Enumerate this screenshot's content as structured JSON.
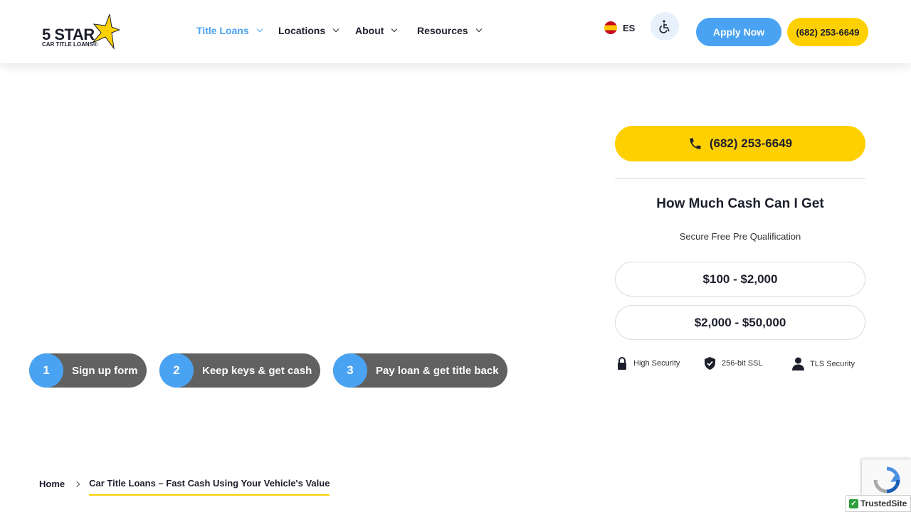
{
  "header": {
    "logo": {
      "big": "5 STAR",
      "small": "CAR TITLE LOANS®"
    },
    "nav": [
      {
        "label": "Title Loans",
        "active": true
      },
      {
        "label": "Locations",
        "active": false
      },
      {
        "label": "About",
        "active": false
      },
      {
        "label": "Resources",
        "active": false
      }
    ],
    "language": "ES",
    "apply_label": "Apply Now",
    "phone": "(682) 253-6649"
  },
  "steps": [
    {
      "number": "1",
      "label": "Sign up form"
    },
    {
      "number": "2",
      "label": "Keep keys & get cash"
    },
    {
      "number": "3",
      "label": "Pay loan & get title back"
    }
  ],
  "sidebar": {
    "phone": "(682) 253-6649",
    "title": "How Much Cash Can I Get",
    "subtitle": "Secure Free Pre Qualification",
    "amounts": [
      "$100 - $2,000",
      "$2,000 - $50,000"
    ],
    "security": [
      "High Security",
      "256-bit SSL",
      "TLS Security"
    ]
  },
  "breadcrumb": {
    "home": "Home",
    "current": "Car Title Loans – Fast Cash Using Your Vehicle's Value"
  },
  "badges": {
    "trusted_site": "TrustedSite"
  },
  "colors": {
    "accent_blue": "#4aa3f2",
    "accent_yellow": "#ffd000",
    "step_gray": "#616161",
    "text_dark": "#1d1f2c"
  }
}
